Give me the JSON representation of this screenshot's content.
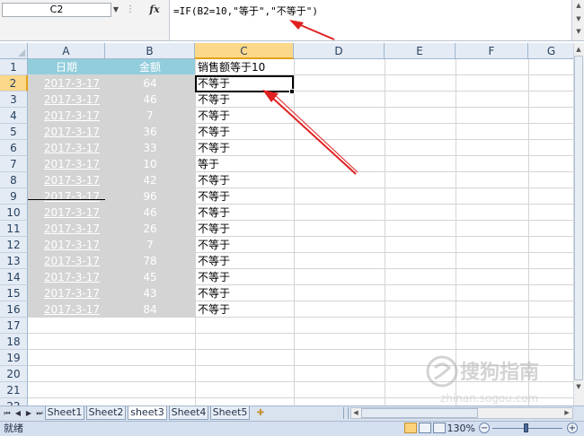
{
  "formula_bar": {
    "name_box": "C2",
    "fx_label": "fx",
    "formula": "=IF(B2=10,\"等于\",\"不等于\")"
  },
  "columns": [
    "A",
    "B",
    "C",
    "D",
    "E",
    "F",
    "G"
  ],
  "rows": [
    "1",
    "2",
    "3",
    "4",
    "5",
    "6",
    "7",
    "8",
    "9",
    "10",
    "11",
    "12",
    "13",
    "14",
    "15",
    "16",
    "17",
    "18",
    "19",
    "20",
    "21",
    "22"
  ],
  "table": {
    "header_a": "日期",
    "header_b": "金额",
    "header_c": "销售额等于10",
    "dates": [
      "2017-3-17",
      "2017-3-17",
      "2017-3-17",
      "2017-3-17",
      "2017-3-17",
      "2017-3-17",
      "2017-3-17",
      "2017-3-17",
      "2017-3-17",
      "2017-3-17",
      "2017-3-17",
      "2017-3-17",
      "2017-3-17",
      "2017-3-17",
      "2017-3-17"
    ],
    "amounts": [
      "64",
      "46",
      "7",
      "36",
      "33",
      "10",
      "42",
      "96",
      "46",
      "26",
      "7",
      "78",
      "45",
      "43",
      "84"
    ],
    "results": [
      "不等于",
      "不等于",
      "不等于",
      "不等于",
      "不等于",
      "等于",
      "不等于",
      "不等于",
      "不等于",
      "不等于",
      "不等于",
      "不等于",
      "不等于",
      "不等于",
      "不等于"
    ]
  },
  "sheet_tabs": [
    "Sheet1",
    "Sheet2",
    "sheet3",
    "Sheet4",
    "Sheet5"
  ],
  "active_sheet_index": 2,
  "status": {
    "ready": "就绪",
    "zoom": "130%",
    "zoom_minus": "−",
    "zoom_plus": "+"
  },
  "watermark": {
    "text": "搜狗指南",
    "url": "zhinan.sogou.com"
  },
  "colors": {
    "header_fill": "#92cddc",
    "data_fill": "#d4d4d4",
    "annotation_arrow": "#e02020",
    "selected_header": "#fcd88a"
  }
}
